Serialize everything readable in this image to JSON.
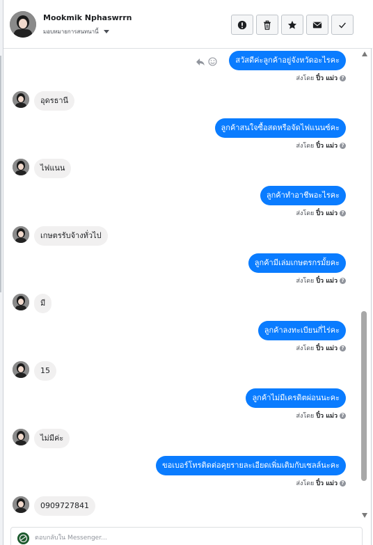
{
  "header": {
    "contact_name": "Mookmik Nphaswrrn",
    "assign_label": "มอบหมายการสนทนานี้",
    "toolbar": [
      {
        "name": "spam-button",
        "icon": "alert-circle-icon"
      },
      {
        "name": "delete-button",
        "icon": "trash-icon"
      },
      {
        "name": "star-button",
        "icon": "star-icon"
      },
      {
        "name": "mark-unread-button",
        "icon": "envelope-icon"
      },
      {
        "name": "mark-done-button",
        "icon": "check-icon"
      }
    ]
  },
  "sent_by_label": "ส่งโดย",
  "sender_name": "ปิ๋ว แม่ว",
  "help_glyph": "?",
  "messages": [
    {
      "dir": "out",
      "text": "สวัสดีค่ะลูกค้าอยู่จังหวัดอะไรคะ"
    },
    {
      "dir": "in",
      "text": "อุดรธานี"
    },
    {
      "dir": "out",
      "text": "ลูกค้าสนใจซื้อสดหรือจัดไฟแนนซ์คะ"
    },
    {
      "dir": "in",
      "text": "ไฟแนน"
    },
    {
      "dir": "out",
      "text": "ลูกค้าทำอาชีพอะไรคะ"
    },
    {
      "dir": "in",
      "text": "เกษตรรับจ้างทั่วไป"
    },
    {
      "dir": "out",
      "text": "ลูกค้ามีเล่มเกษตรกรมั้ยคะ"
    },
    {
      "dir": "in",
      "text": "มี"
    },
    {
      "dir": "out",
      "text": "ลูกค้าลงทะเบียนกี่ไร่คะ"
    },
    {
      "dir": "in",
      "text": "15"
    },
    {
      "dir": "out",
      "text": "ลูกค้าไม่มีเครดิตผ่อนนะคะ"
    },
    {
      "dir": "in",
      "text": "ไม่มีค่ะ"
    },
    {
      "dir": "out",
      "text": "ขอเบอร์โทรติดต่อคุยรายละเอียดเพิ่มเติมกับเซลล์นะคะ"
    },
    {
      "dir": "in",
      "text": "0909727841"
    }
  ],
  "composer": {
    "placeholder": "ตอบกลับใน Messenger..."
  },
  "colors": {
    "outgoing_bubble": "#0a7cff",
    "incoming_bubble": "#f1f0f0",
    "header_border": "#dddfe2"
  }
}
